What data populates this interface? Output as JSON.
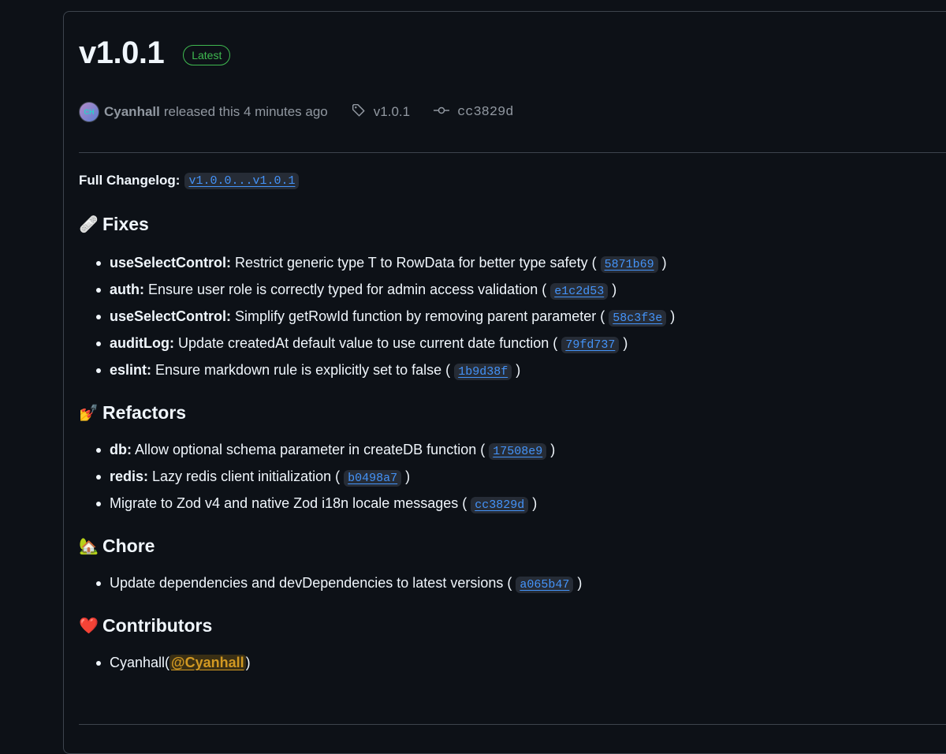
{
  "release": {
    "title": "v1.0.1",
    "badge": "Latest",
    "avatar_initials": "CH",
    "author": "Cyanhall",
    "released_text": "released this 4 minutes ago",
    "tag": "v1.0.1",
    "commit": "cc3829d"
  },
  "changelog": {
    "label": "Full Changelog:",
    "range": "v1.0.0...v1.0.1"
  },
  "sections": {
    "fixes": {
      "icon": "bandage-icon",
      "emoji": "🩹",
      "title": "Fixes",
      "items": [
        {
          "scope": "useSelectControl:",
          "text": " Restrict generic type T to RowData for better type safety (",
          "commit": "5871b69"
        },
        {
          "scope": "auth:",
          "text": " Ensure user role is correctly typed for admin access validation (",
          "commit": "e1c2d53"
        },
        {
          "scope": "useSelectControl:",
          "text": " Simplify getRowId function by removing parent parameter (",
          "commit": "58c3f3e"
        },
        {
          "scope": "auditLog:",
          "text": " Update createdAt default value to use current date function (",
          "commit": "79fd737"
        },
        {
          "scope": "eslint:",
          "text": " Ensure markdown rule is explicitly set to false (",
          "commit": "1b9d38f"
        }
      ]
    },
    "refactors": {
      "icon": "nail-polish-icon",
      "emoji": "💅",
      "title": "Refactors",
      "items": [
        {
          "scope": "db:",
          "text": " Allow optional schema parameter in createDB function (",
          "commit": "17508e9"
        },
        {
          "scope": "redis:",
          "text": " Lazy redis client initialization (",
          "commit": "b0498a7"
        },
        {
          "scope": "",
          "text": "Migrate to Zod v4 and native Zod i18n locale messages (",
          "commit": "cc3829d"
        }
      ]
    },
    "chore": {
      "icon": "house-icon",
      "emoji": "🏡",
      "title": "Chore",
      "items": [
        {
          "scope": "",
          "text": "Update dependencies and devDependencies to latest versions (",
          "commit": "a065b47"
        }
      ]
    },
    "contributors": {
      "icon": "heart-icon",
      "emoji": "❤️",
      "title": "Contributors",
      "name": "Cyanhall(",
      "mention": "@Cyanhall",
      "close": ")"
    }
  },
  "colors": {
    "background": "#0d1117",
    "link": "#4493f8",
    "badge_green": "#3fb950",
    "mention": "#d29922",
    "muted": "#9198a1"
  }
}
